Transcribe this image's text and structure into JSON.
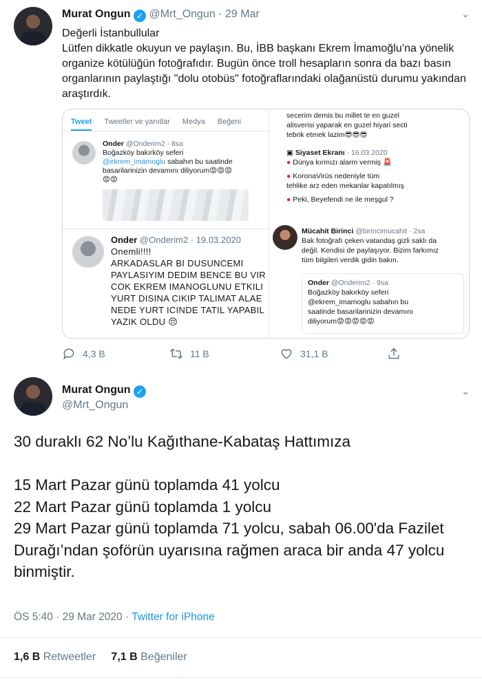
{
  "tweet1": {
    "display_name": "Murat Ongun",
    "handle": "@Mrt_Ongun",
    "date": "29 Mar",
    "text_lines": [
      "Değerli İstanbullular",
      "Lütfen dikkatle okuyun ve paylaşın. Bu, İBB başkanı Ekrem İmamoğlu’na yönelik organize kötülüğün fotoğrafıdır. Bugün önce troll hesapların sonra da bazı basın organlarının paylaştığı \"dolu otobüs\" fotoğraflarındaki olağanüstü durumu yakından araştırdık."
    ],
    "media": {
      "tabs": [
        "Tweet",
        "Tweetler ve yanıtlar",
        "Medya",
        "Beğeni"
      ],
      "left_tweet_1": {
        "name": "Onder",
        "handle_time": "@Onderim2 · 8sa",
        "line1": "Boğazköy bakırköy seferi",
        "mention": "@ekrem_imamoglu",
        "line2": " sabahın bu saatinde",
        "line3": "basarilarinizin devamını diliyorum😡😡😡",
        "line4": "😡😡"
      },
      "left_tweet_2": {
        "name": "Onder",
        "handle_time": "@Onderim2 · 19.03.2020",
        "lines": [
          "Onemli!!!!",
          "ARKADASLAR BI DUSUNCEMI",
          "PAYLASIYIM DEDIM BENCE BU VIR",
          "COK EKREM IMANOGLUNU ETKILI",
          "YURT DISINA CIKIP TALIMAT ALAE",
          "NEDE YURT ICINDE TATIL YAPABIL",
          "YAZIK OLDU 😔"
        ]
      },
      "right_top_lines": [
        "secerim demis bu millet te en guzel",
        "alisverisi yaparak en guzel hiyari secti",
        "tebrik etmek lazim😎😎😎"
      ],
      "siyaset": {
        "name": "Siyaset Ekranı",
        "date": "· 16.03.2020",
        "lines": [
          "Dünya kırmızı alarm vermiş 🚨",
          "KoronaVirüs nedeniyle tüm",
          "tehlike arz eden mekanlar kapatılmış",
          "Peki, Beyefendi ne ile meşgul ?"
        ]
      },
      "mucahit": {
        "name": "Mücahit Birinci",
        "handle_time": "@birincimucahit · 2sa",
        "lines": [
          "Bak fotoğrafı çeken vatandaş gizli saklı da",
          "değil. Kendisi de paylaşıyor. Bizim farkımız",
          "tüm bilgileri verdik gidin bakın."
        ]
      },
      "quoted": {
        "name": "Onder",
        "handle_time": "@Onderim2 · 9sa",
        "lines": [
          "Boğazköy bakırköy seferi",
          "@ekrem_imamoglu sabahın bu",
          "saatinde basarilarinizin devamını",
          "diliyorum😡😡😡😡😡"
        ]
      }
    },
    "actions": {
      "replies": "4,3 B",
      "retweets": "11 B",
      "likes": "31,1 B"
    }
  },
  "tweet2": {
    "display_name": "Murat Ongun",
    "handle": "@Mrt_Ongun",
    "text_lines": [
      "30 duraklı 62 No’lu Kağıthane-Kabataş Hattımıza",
      "",
      "15 Mart Pazar günü  toplamda 41 yolcu",
      "22 Mart  Pazar günü toplamda 1 yolcu",
      "29 Mart Pazar günü toplamda 71 yolcu, sabah 06.00'da Fazilet Durağı’ndan şoförün uyarısına rağmen araca bir anda 47 yolcu binmiştir."
    ],
    "time": "ÖS 5:40 · 29 Mar 2020 · ",
    "source": "Twitter for iPhone",
    "retweet_count": "1,6 B",
    "retweet_label": "Retweetler",
    "like_count": "7,1 B",
    "like_label": "Beğeniler"
  },
  "colors": {
    "accent": "#1da1f2",
    "link": "#1b95e0",
    "muted": "#657786"
  }
}
